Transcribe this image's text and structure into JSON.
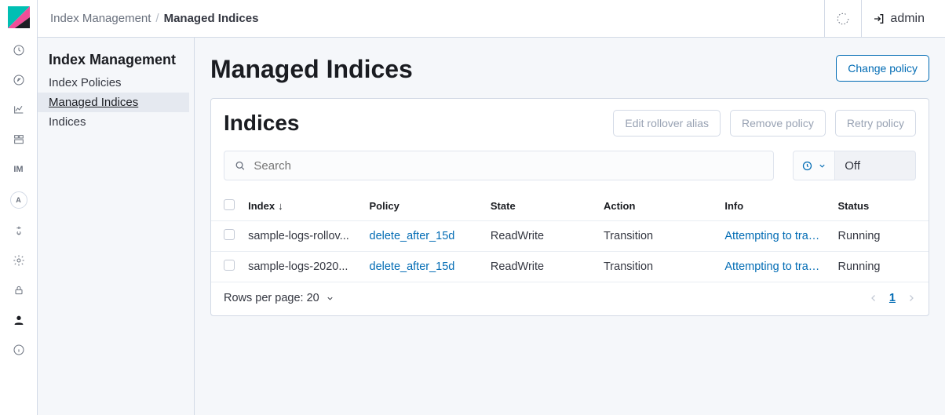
{
  "topbar": {
    "breadcrumb_root": "Index Management",
    "breadcrumb_current": "Managed Indices",
    "user_label": "admin"
  },
  "sidebar": {
    "title": "Index Management",
    "items": [
      {
        "label": "Index Policies"
      },
      {
        "label": "Managed Indices"
      },
      {
        "label": "Indices"
      }
    ]
  },
  "page": {
    "title": "Managed Indices",
    "change_policy_label": "Change policy"
  },
  "panel": {
    "title": "Indices",
    "edit_rollover_label": "Edit rollover alias",
    "remove_policy_label": "Remove policy",
    "retry_policy_label": "Retry policy",
    "search_placeholder": "Search",
    "refresh_state": "Off"
  },
  "table": {
    "columns": {
      "index": "Index",
      "policy": "Policy",
      "state": "State",
      "action": "Action",
      "info": "Info",
      "status": "Status"
    },
    "rows": [
      {
        "index": "sample-logs-rollov...",
        "policy": "delete_after_15d",
        "state": "ReadWrite",
        "action": "Transition",
        "info": "Attempting to transit",
        "status": "Running"
      },
      {
        "index": "sample-logs-2020...",
        "policy": "delete_after_15d",
        "state": "ReadWrite",
        "action": "Transition",
        "info": "Attempting to transit",
        "status": "Running"
      }
    ],
    "rows_per_page_label": "Rows per page: 20",
    "current_page": "1"
  }
}
